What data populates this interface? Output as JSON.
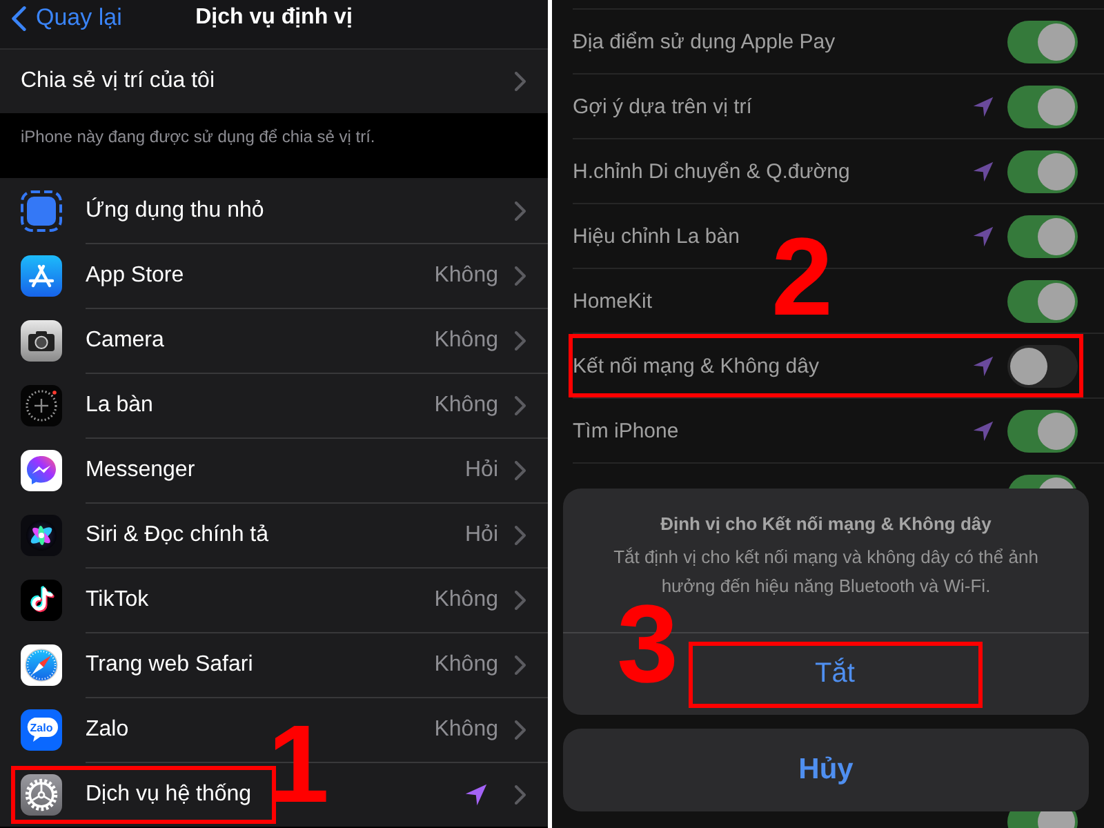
{
  "left": {
    "nav": {
      "back": "Quay lại",
      "title": "Dịch vụ định vị"
    },
    "share": {
      "label": "Chia sẻ vị trí của tôi"
    },
    "share_note": "iPhone này đang được sử dụng để chia sẻ vị trí.",
    "apps": [
      {
        "kind": "widget",
        "name": "Ứng dụng thu nhỏ",
        "location_used": false,
        "highlighted": false
      },
      {
        "kind": "store",
        "name": "App Store",
        "value": "Không",
        "location_used": false,
        "highlighted": false
      },
      {
        "kind": "camera",
        "name": "Camera",
        "value": "Không",
        "location_used": false,
        "highlighted": false
      },
      {
        "kind": "compass",
        "name": "La bàn",
        "value": "Không",
        "location_used": false,
        "highlighted": false
      },
      {
        "kind": "lightning",
        "name": "Messenger",
        "value": "Hỏi",
        "location_used": false,
        "highlighted": false
      },
      {
        "kind": "orb",
        "name": "Siri & Đọc chính tả",
        "value": "Hỏi",
        "location_used": false,
        "highlighted": false
      },
      {
        "kind": "note",
        "name": "TikTok",
        "value": "Không",
        "location_used": false,
        "highlighted": false
      },
      {
        "kind": "needle",
        "name": "Trang web Safari",
        "value": "Không",
        "location_used": false,
        "highlighted": false
      },
      {
        "kind": "bubble",
        "name": "Zalo",
        "logo_text": "Zalo",
        "value": "Không",
        "location_used": false,
        "highlighted": false
      },
      {
        "kind": "gear",
        "name": "Dịch vụ hệ thống",
        "location_used": true,
        "highlighted": true,
        "annotation": "1"
      }
    ]
  },
  "right": {
    "services": [
      {
        "label": "Địa điểm sử dụng Apple Pay",
        "location_used": false,
        "on": true,
        "highlighted": false
      },
      {
        "label": "Gợi ý dựa trên vị trí",
        "location_used": true,
        "on": true,
        "highlighted": false
      },
      {
        "label": "H.chỉnh Di chuyển & Q.đường",
        "location_used": true,
        "on": true,
        "highlighted": false
      },
      {
        "label": "Hiệu chỉnh La bàn",
        "location_used": true,
        "on": true,
        "highlighted": false
      },
      {
        "label": "HomeKit",
        "location_used": false,
        "on": true,
        "highlighted": false
      },
      {
        "label": "Kết nối mạng & Không dây",
        "location_used": true,
        "on": false,
        "highlighted": true,
        "annotation": "2"
      },
      {
        "label": "Tìm iPhone",
        "location_used": true,
        "on": true,
        "highlighted": false
      },
      {
        "on": true,
        "highlighted": false
      }
    ],
    "services_below": [
      {
        "on": true,
        "highlighted": false
      }
    ],
    "action_sheet": {
      "title": "Định vị cho Kết nối mạng & Không dây",
      "message": "Tắt định vị cho kết nối mạng và không dây có thể ảnh hưởng đến hiệu năng Bluetooth và Wi-Fi.",
      "confirm": {
        "label": "Tắt",
        "highlighted": true,
        "annotation": "3"
      },
      "cancel": "Hủy"
    }
  }
}
